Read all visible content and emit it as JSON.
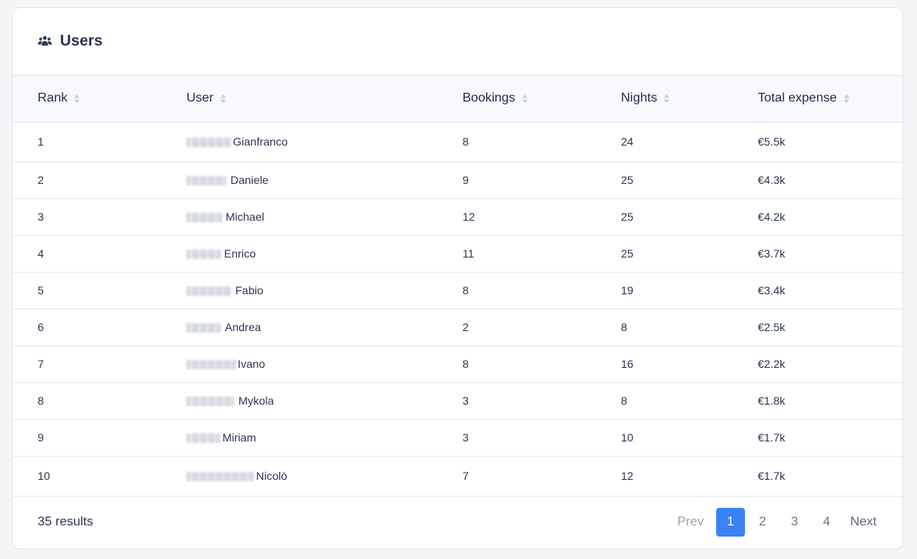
{
  "header": {
    "title": "Users",
    "icon": "users-icon"
  },
  "table": {
    "columns": [
      "Rank",
      "User",
      "Bookings",
      "Nights",
      "Total expense"
    ],
    "rows": [
      {
        "rank": "1",
        "name": "Gianfranco",
        "bookings": "8",
        "nights": "24",
        "expense": "€5.5k"
      },
      {
        "rank": "2",
        "name": "Daniele",
        "bookings": "9",
        "nights": "25",
        "expense": "€4.3k"
      },
      {
        "rank": "3",
        "name": "Michael",
        "bookings": "12",
        "nights": "25",
        "expense": "€4.2k"
      },
      {
        "rank": "4",
        "name": "Enrico",
        "bookings": "11",
        "nights": "25",
        "expense": "€3.7k"
      },
      {
        "rank": "5",
        "name": "Fabio",
        "bookings": "8",
        "nights": "19",
        "expense": "€3.4k"
      },
      {
        "rank": "6",
        "name": "Andrea",
        "bookings": "2",
        "nights": "8",
        "expense": "€2.5k"
      },
      {
        "rank": "7",
        "name": "Ivano",
        "bookings": "8",
        "nights": "16",
        "expense": "€2.2k"
      },
      {
        "rank": "8",
        "name": "Mykola",
        "bookings": "3",
        "nights": "8",
        "expense": "€1.8k"
      },
      {
        "rank": "9",
        "name": "Miriam",
        "bookings": "3",
        "nights": "10",
        "expense": "€1.7k"
      },
      {
        "rank": "10",
        "name": "Nicolò",
        "bookings": "7",
        "nights": "12",
        "expense": "€1.7k"
      }
    ]
  },
  "footer": {
    "results": "35 results",
    "prev": "Prev",
    "pages": [
      "1",
      "2",
      "3",
      "4"
    ],
    "active_page": "1",
    "next": "Next"
  },
  "colors": {
    "accent": "#3b82f6"
  }
}
